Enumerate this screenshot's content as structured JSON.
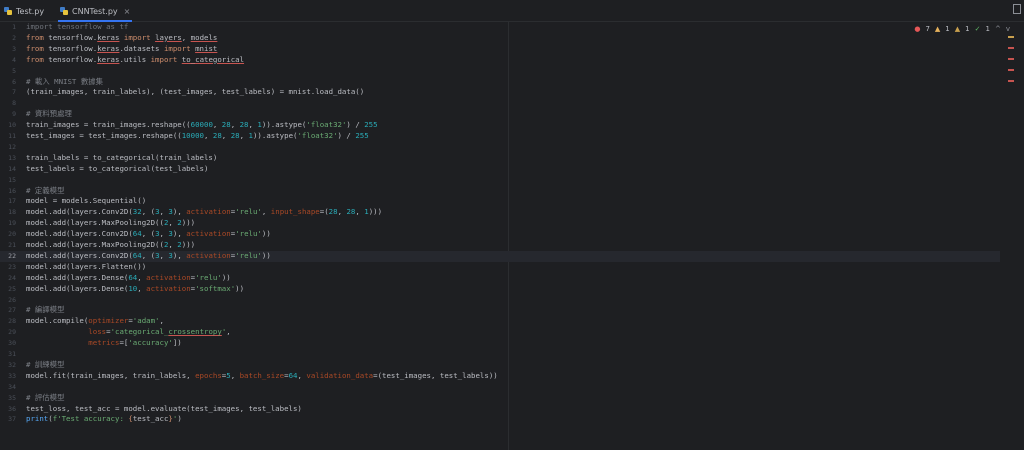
{
  "tabs": [
    {
      "label": "Test.py",
      "active": false
    },
    {
      "label": "CNNTest.py",
      "active": true,
      "close": "×"
    }
  ],
  "inspections": {
    "errors": "7",
    "warnings": "1",
    "weak_warnings": "1",
    "typos": "1",
    "up": "^",
    "down": "v"
  },
  "current_line": 22,
  "lines": [
    [
      {
        "t": "import tensorflow as tf",
        "c": "dim"
      }
    ],
    [
      {
        "t": "from ",
        "c": "kw"
      },
      {
        "t": "tensorflow."
      },
      {
        "t": "keras",
        "c": "ul"
      },
      {
        "t": " "
      },
      {
        "t": "import",
        "c": "kw"
      },
      {
        "t": " "
      },
      {
        "t": "layers",
        "c": "ul"
      },
      {
        "t": ", "
      },
      {
        "t": "models",
        "c": "ul"
      }
    ],
    [
      {
        "t": "from ",
        "c": "kw"
      },
      {
        "t": "tensorflow."
      },
      {
        "t": "keras",
        "c": "ul"
      },
      {
        "t": ".datasets "
      },
      {
        "t": "import",
        "c": "kw"
      },
      {
        "t": " "
      },
      {
        "t": "mnist",
        "c": "ul"
      }
    ],
    [
      {
        "t": "from ",
        "c": "kw"
      },
      {
        "t": "tensorflow."
      },
      {
        "t": "keras",
        "c": "ul"
      },
      {
        "t": ".utils "
      },
      {
        "t": "import",
        "c": "kw"
      },
      {
        "t": " "
      },
      {
        "t": "to_categorical",
        "c": "ul"
      }
    ],
    [],
    [
      {
        "t": "# 載入 MNIST 數據集",
        "c": "cm"
      }
    ],
    [
      {
        "t": "(train_images, train_labels), (test_images, test_labels) = mnist.load_data()"
      }
    ],
    [],
    [
      {
        "t": "# 資料預處理",
        "c": "cm"
      }
    ],
    [
      {
        "t": "train_images = train_images.reshape(("
      },
      {
        "t": "60000",
        "c": "num"
      },
      {
        "t": ", "
      },
      {
        "t": "28",
        "c": "num"
      },
      {
        "t": ", "
      },
      {
        "t": "28",
        "c": "num"
      },
      {
        "t": ", "
      },
      {
        "t": "1",
        "c": "num"
      },
      {
        "t": ")).astype("
      },
      {
        "t": "'float32'",
        "c": "str"
      },
      {
        "t": ") / "
      },
      {
        "t": "255",
        "c": "num"
      }
    ],
    [
      {
        "t": "test_images = test_images.reshape(("
      },
      {
        "t": "10000",
        "c": "num"
      },
      {
        "t": ", "
      },
      {
        "t": "28",
        "c": "num"
      },
      {
        "t": ", "
      },
      {
        "t": "28",
        "c": "num"
      },
      {
        "t": ", "
      },
      {
        "t": "1",
        "c": "num"
      },
      {
        "t": ")).astype("
      },
      {
        "t": "'float32'",
        "c": "str"
      },
      {
        "t": ") / "
      },
      {
        "t": "255",
        "c": "num"
      }
    ],
    [],
    [
      {
        "t": "train_labels = to_categorical(train_labels)"
      }
    ],
    [
      {
        "t": "test_labels = to_categorical(test_labels)"
      }
    ],
    [],
    [
      {
        "t": "# 定義模型",
        "c": "cm"
      }
    ],
    [
      {
        "t": "model = models.Sequential()"
      }
    ],
    [
      {
        "t": "model.add(layers.Conv2D("
      },
      {
        "t": "32",
        "c": "num"
      },
      {
        "t": ", ("
      },
      {
        "t": "3",
        "c": "num"
      },
      {
        "t": ", "
      },
      {
        "t": "3",
        "c": "num"
      },
      {
        "t": "), "
      },
      {
        "t": "activation",
        "c": "par"
      },
      {
        "t": "="
      },
      {
        "t": "'relu'",
        "c": "str"
      },
      {
        "t": ", "
      },
      {
        "t": "input_shape",
        "c": "par"
      },
      {
        "t": "=("
      },
      {
        "t": "28",
        "c": "num"
      },
      {
        "t": ", "
      },
      {
        "t": "28",
        "c": "num"
      },
      {
        "t": ", "
      },
      {
        "t": "1",
        "c": "num"
      },
      {
        "t": ")))"
      }
    ],
    [
      {
        "t": "model.add(layers.MaxPooling2D(("
      },
      {
        "t": "2",
        "c": "num"
      },
      {
        "t": ", "
      },
      {
        "t": "2",
        "c": "num"
      },
      {
        "t": ")))"
      }
    ],
    [
      {
        "t": "model.add(layers.Conv2D("
      },
      {
        "t": "64",
        "c": "num"
      },
      {
        "t": ", ("
      },
      {
        "t": "3",
        "c": "num"
      },
      {
        "t": ", "
      },
      {
        "t": "3",
        "c": "num"
      },
      {
        "t": "), "
      },
      {
        "t": "activation",
        "c": "par"
      },
      {
        "t": "="
      },
      {
        "t": "'relu'",
        "c": "str"
      },
      {
        "t": "))"
      }
    ],
    [
      {
        "t": "model.add(layers.MaxPooling2D(("
      },
      {
        "t": "2",
        "c": "num"
      },
      {
        "t": ", "
      },
      {
        "t": "2",
        "c": "num"
      },
      {
        "t": ")))"
      }
    ],
    [
      {
        "t": "model.add(layers.Conv2D("
      },
      {
        "t": "64",
        "c": "num"
      },
      {
        "t": ", ("
      },
      {
        "t": "3",
        "c": "num"
      },
      {
        "t": ", "
      },
      {
        "t": "3",
        "c": "num"
      },
      {
        "t": "), "
      },
      {
        "t": "activation",
        "c": "par"
      },
      {
        "t": "="
      },
      {
        "t": "'relu'",
        "c": "str"
      },
      {
        "t": "))"
      }
    ],
    [
      {
        "t": "model.add(layers.Flatten())"
      }
    ],
    [
      {
        "t": "model.add(layers.Dense("
      },
      {
        "t": "64",
        "c": "num"
      },
      {
        "t": ", "
      },
      {
        "t": "activation",
        "c": "par"
      },
      {
        "t": "="
      },
      {
        "t": "'relu'",
        "c": "str"
      },
      {
        "t": "))"
      }
    ],
    [
      {
        "t": "model.add(layers.Dense("
      },
      {
        "t": "10",
        "c": "num"
      },
      {
        "t": ", "
      },
      {
        "t": "activation",
        "c": "par"
      },
      {
        "t": "="
      },
      {
        "t": "'softmax'",
        "c": "str"
      },
      {
        "t": "))"
      }
    ],
    [],
    [
      {
        "t": "# 編譯模型",
        "c": "cm"
      }
    ],
    [
      {
        "t": "model.compile("
      },
      {
        "t": "optimizer",
        "c": "par"
      },
      {
        "t": "="
      },
      {
        "t": "'adam'",
        "c": "str"
      },
      {
        "t": ","
      }
    ],
    [
      {
        "t": "              "
      },
      {
        "t": "loss",
        "c": "par"
      },
      {
        "t": "="
      },
      {
        "t": "'categorical_",
        "c": "str"
      },
      {
        "t": "crossentropy",
        "c": "str ul"
      },
      {
        "t": "'",
        "c": "str"
      },
      {
        "t": ","
      }
    ],
    [
      {
        "t": "              "
      },
      {
        "t": "metrics",
        "c": "par"
      },
      {
        "t": "=["
      },
      {
        "t": "'accuracy'",
        "c": "str"
      },
      {
        "t": "])"
      }
    ],
    [],
    [
      {
        "t": "# 訓練模型",
        "c": "cm"
      }
    ],
    [
      {
        "t": "model.fit(train_images, train_labels, "
      },
      {
        "t": "epochs",
        "c": "par"
      },
      {
        "t": "="
      },
      {
        "t": "5",
        "c": "num"
      },
      {
        "t": ", "
      },
      {
        "t": "batch_size",
        "c": "par"
      },
      {
        "t": "="
      },
      {
        "t": "64",
        "c": "num"
      },
      {
        "t": ", "
      },
      {
        "t": "validation_data",
        "c": "par"
      },
      {
        "t": "=(test_images, test_labels))"
      }
    ],
    [],
    [
      {
        "t": "# 評估模型",
        "c": "cm"
      }
    ],
    [
      {
        "t": "test_loss, test_acc = model.evaluate(test_images, test_labels)"
      }
    ],
    [
      {
        "t": "print",
        "c": "fn"
      },
      {
        "t": "("
      },
      {
        "t": "f'Test accuracy: ",
        "c": "str"
      },
      {
        "t": "{",
        "c": "kw"
      },
      {
        "t": "test_acc"
      },
      {
        "t": "}",
        "c": "kw"
      },
      {
        "t": "'",
        "c": "str"
      },
      {
        "t": ")"
      }
    ]
  ],
  "colors": {
    "background": "#1e1f22",
    "keyword": "#cf8e6d",
    "string": "#6aab73",
    "number": "#2aacb8",
    "comment": "#7a7e85",
    "parameter": "#aa4926",
    "error_marker": "#c75450",
    "warning_marker": "#c9a04e"
  },
  "stripe_marks": [
    {
      "line": 1,
      "color": "#c9a04e"
    },
    {
      "line": 2,
      "color": "#c75450"
    },
    {
      "line": 3,
      "color": "#c75450"
    },
    {
      "line": 4,
      "color": "#c75450"
    },
    {
      "line": 5,
      "color": "#c75450"
    }
  ]
}
